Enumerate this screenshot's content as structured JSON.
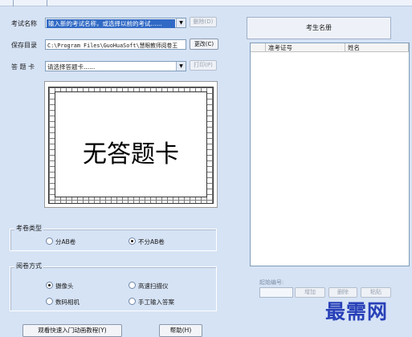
{
  "form": {
    "exam_name_label": "考试名称",
    "exam_name_value": "输入新的考试名称，或选择以前的考试......",
    "delete_label": "删除(D)",
    "save_dir_label": "保存目录",
    "save_dir_value": "C:\\Program Files\\GuoHuaSoft\\慧眼教师阅卷王",
    "change_label": "更改(C)",
    "answer_card_label": "答 题 卡",
    "answer_card_value": "请选择答题卡......",
    "print_label": "打印(P)"
  },
  "card_preview": {
    "text": "无答题卡"
  },
  "exam_type": {
    "title": "考卷类型",
    "options": [
      {
        "label": "分AB卷",
        "selected": false
      },
      {
        "label": "不分AB卷",
        "selected": true
      }
    ]
  },
  "grading_method": {
    "title": "阅卷方式",
    "options": [
      {
        "label": "摄像头",
        "selected": true
      },
      {
        "label": "高速扫描仪",
        "selected": false
      },
      {
        "label": "数码相机",
        "selected": false
      },
      {
        "label": "手工输入答案",
        "selected": false
      }
    ]
  },
  "student_list": {
    "header": "考生名册",
    "columns": [
      "准考证号",
      "姓名"
    ]
  },
  "start_number": {
    "label": "起始编号:",
    "value": "",
    "add_label": "增加",
    "delete_label": "删除",
    "paste_label": "粘贴"
  },
  "bottom": {
    "tutorial_label": "观看快速入门动画教程(Y)",
    "help_label": "帮助(H)"
  },
  "watermark": {
    "text": "最需网"
  },
  "colors": {
    "background": "#d6e3f5",
    "selection": "#316ac5",
    "watermark": "#2840b8"
  }
}
